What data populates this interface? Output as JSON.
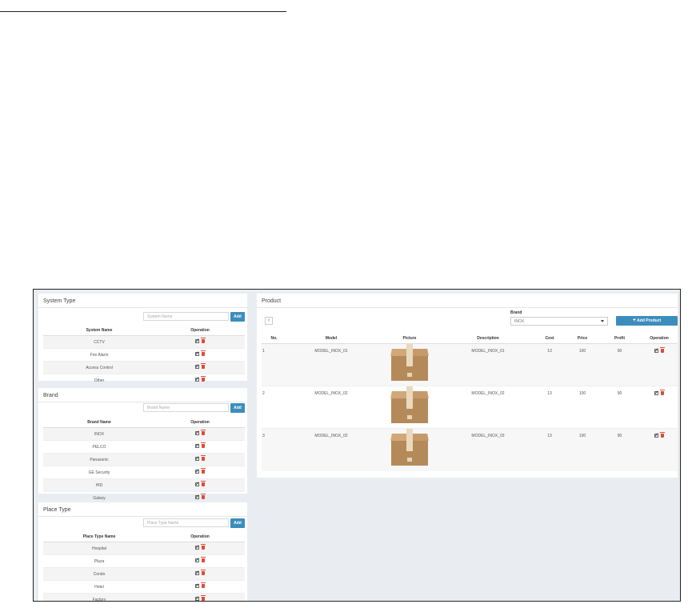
{
  "system_type": {
    "title": "System Type",
    "input_placeholder": "System Name",
    "add_label": "Add",
    "columns": [
      "System Name",
      "Operation"
    ],
    "rows": [
      "CCTV",
      "Fire Alarm",
      "Access Control",
      "Other"
    ]
  },
  "brand": {
    "title": "Brand",
    "input_placeholder": "Brand Name",
    "add_label": "Add",
    "columns": [
      "Brand Name",
      "Operation"
    ],
    "rows": [
      "INOX",
      "PELCO",
      "Panasonic",
      "GE Security",
      "HID",
      "Galaxy"
    ]
  },
  "place_type": {
    "title": "Place Type",
    "input_placeholder": "Place Type Name",
    "add_label": "Add",
    "columns": [
      "Place Type Name",
      "Operation"
    ],
    "rows": [
      "Hospital",
      "Plaza",
      "Condo",
      "Hotel",
      "Factory"
    ]
  },
  "product": {
    "title": "Product",
    "back_glyph": "‹",
    "brand_label": "Brand",
    "brand_selected": "INOX",
    "add_product_label": "Add Product",
    "columns": [
      "No.",
      "Model",
      "Picture",
      "Description",
      "Cost",
      "Price",
      "Profit",
      "Operation"
    ],
    "rows": [
      {
        "no": "1",
        "model": "MODEL_INOX_01",
        "description": "MODEL_INOX_01",
        "cost": "13",
        "price": "100",
        "profit": "90"
      },
      {
        "no": "2",
        "model": "MODEL_INOX_02",
        "description": "MODEL_INOX_02",
        "cost": "13",
        "price": "100",
        "profit": "90"
      },
      {
        "no": "3",
        "model": "MODEL_INOX_02",
        "description": "MODEL_INOX_03",
        "cost": "13",
        "price": "100",
        "profit": "90"
      }
    ]
  }
}
